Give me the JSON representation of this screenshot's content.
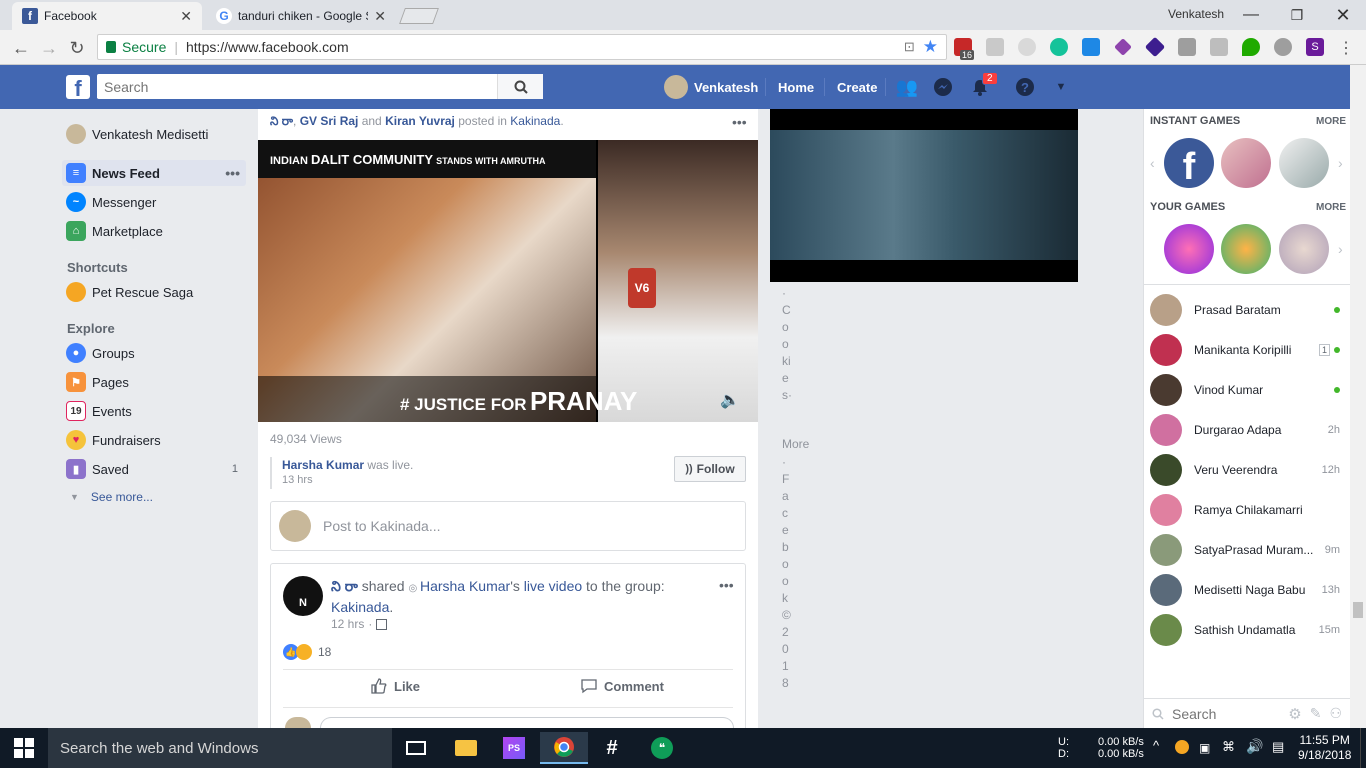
{
  "browser": {
    "tabs": [
      {
        "title": "Facebook",
        "active": true,
        "favicon_color": "#3b5998"
      },
      {
        "title": "tanduri chiken - Google S",
        "active": false,
        "favicon_color": "#4285f4"
      }
    ],
    "profile_name": "Venkatesh",
    "secure_label": "Secure",
    "url": "https://www.facebook.com",
    "extension_badge": "16"
  },
  "fb": {
    "brand_color": "#4267b2",
    "search_placeholder": "Search",
    "user_name": "Venkatesh",
    "nav_home": "Home",
    "nav_create": "Create",
    "notification_count": "2"
  },
  "left_nav": {
    "profile": "Venkatesh Medisetti",
    "items": [
      {
        "label": "News Feed",
        "icon": "news-feed-icon"
      },
      {
        "label": "Messenger",
        "icon": "messenger-icon"
      },
      {
        "label": "Marketplace",
        "icon": "marketplace-icon"
      }
    ],
    "shortcuts_heading": "Shortcuts",
    "shortcuts": [
      {
        "label": "Pet Rescue Saga"
      }
    ],
    "explore_heading": "Explore",
    "explore": [
      {
        "label": "Groups",
        "icon": "groups-icon"
      },
      {
        "label": "Pages",
        "icon": "pages-icon"
      },
      {
        "label": "Events",
        "icon": "events-icon",
        "icon_text": "19"
      },
      {
        "label": "Fundraisers",
        "icon": "fundraisers-icon"
      },
      {
        "label": "Saved",
        "icon": "saved-icon",
        "count": "1"
      }
    ],
    "see_more": "See more..."
  },
  "feed": {
    "post1": {
      "author_line_start": "ని రా",
      "coauthor1": "GV Sri Raj",
      "and": " and ",
      "coauthor2": "Kiran Yuvraj",
      "posted_in": " posted in ",
      "group": "Kakinada",
      "video_banner_prefix": "INDIAN",
      "video_banner": "DALIT COMMUNITY",
      "video_banner_suffix": "STANDS WITH AMRUTHA",
      "video_hashtag": "# JUSTICE FOR",
      "video_hashtag_name": "PRANAY",
      "channel_logo": "V6",
      "views": "49,034 Views",
      "live_author": "Harsha Kumar",
      "live_text": " was live.",
      "live_time": "13 hrs",
      "follow_label": "Follow"
    },
    "composer_placeholder": "Post to Kakinada...",
    "post2": {
      "avatar_letter": "N",
      "author": "ని రా",
      "shared": " shared ",
      "original_author": "Harsha Kumar",
      "apostrophe": "'s ",
      "live_video": "live video",
      "to_group": " to the group:",
      "group": "Kakinada",
      "time": "12 hrs",
      "reactions": "18",
      "like": "Like",
      "comment": "Comment"
    }
  },
  "middle_column": {
    "vertical_text1": "·Cookies·",
    "more": "More",
    "vertical_text2": "·Facebook©2018"
  },
  "right_panel": {
    "instant_games": "INSTANT GAMES",
    "your_games": "YOUR GAMES",
    "more": "MORE",
    "contacts": [
      {
        "name": "Prasad Baratam",
        "status": "online"
      },
      {
        "name": "Manikanta Koripilli",
        "status": "online",
        "badge": "1"
      },
      {
        "name": "Vinod Kumar",
        "status": "online"
      },
      {
        "name": "Durgarao Adapa",
        "status": "2h"
      },
      {
        "name": "Veru Veerendra",
        "status": "12h"
      },
      {
        "name": "Ramya Chilakamarri",
        "status": ""
      },
      {
        "name": "SatyaPrasad Muram...",
        "status": "9m"
      },
      {
        "name": "Medisetti Naga Babu",
        "status": "13h"
      },
      {
        "name": "Sathish Undamatla",
        "status": "15m"
      }
    ],
    "chat_search": "Search"
  },
  "taskbar": {
    "search": "Search the web and Windows",
    "net_up_label": "U:",
    "net_down_label": "D:",
    "net_up": "0.00 kB/s",
    "net_down": "0.00 kB/s",
    "time": "11:55 PM",
    "date": "9/18/2018"
  }
}
